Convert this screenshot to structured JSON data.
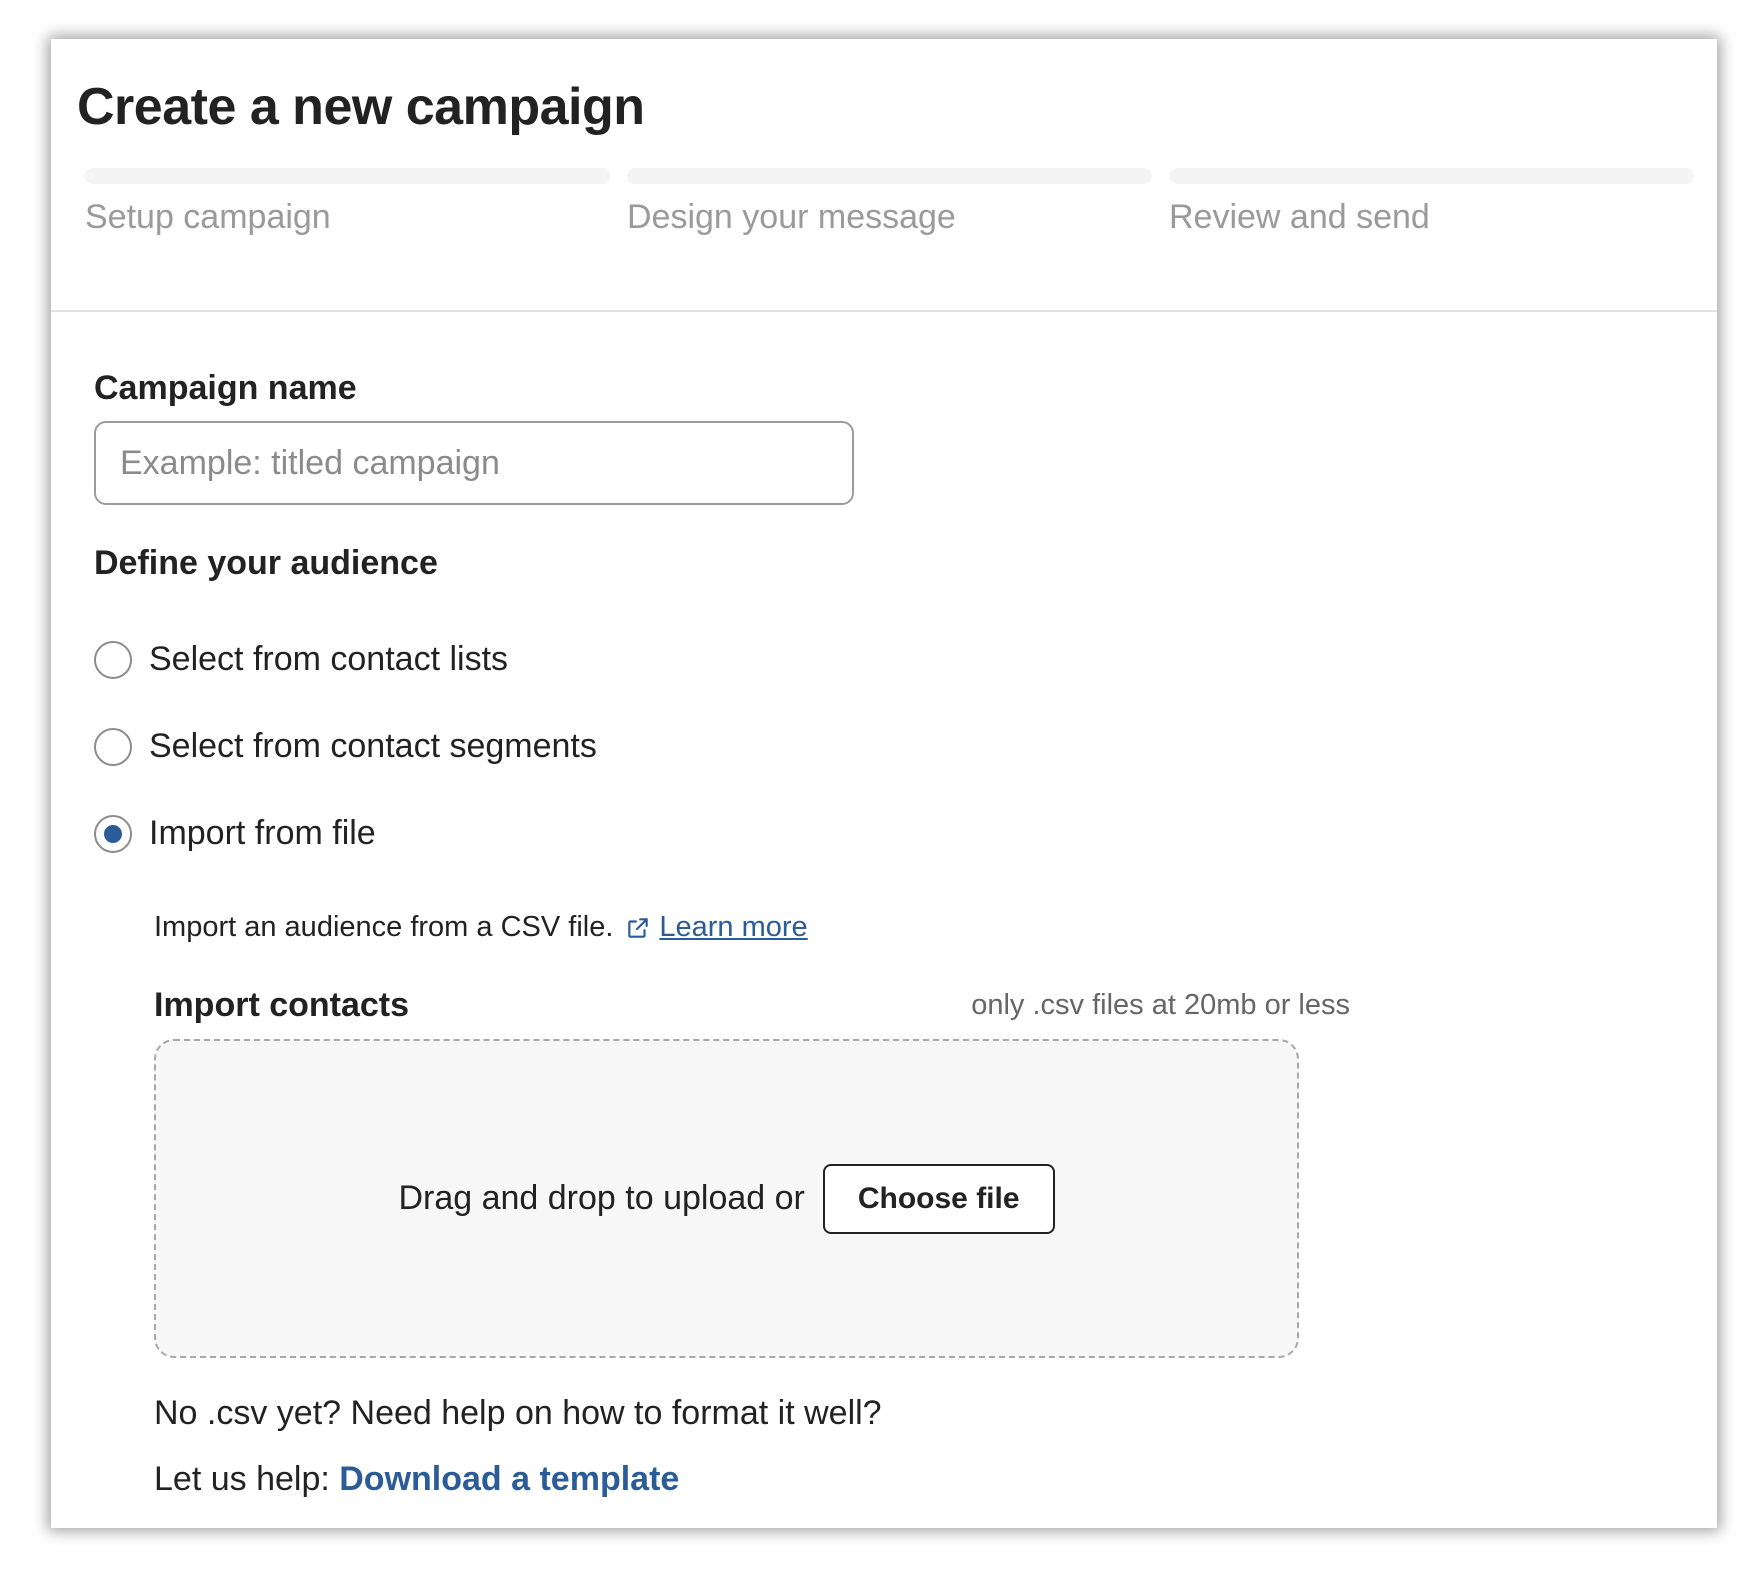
{
  "page": {
    "title": "Create a new campaign"
  },
  "steps": [
    {
      "label": "Setup campaign"
    },
    {
      "label": "Design your message"
    },
    {
      "label": "Review and send"
    }
  ],
  "campaign_name": {
    "label": "Campaign name",
    "value": "",
    "placeholder": "Example: titled campaign"
  },
  "audience": {
    "label": "Define your audience",
    "options": [
      {
        "label": "Select from contact lists",
        "selected": false
      },
      {
        "label": "Select from contact segments",
        "selected": false
      },
      {
        "label": "Import from file",
        "selected": true
      }
    ],
    "import_description": "Import an audience from a CSV file.",
    "learn_more_label": "Learn more",
    "import_icon": "external-link-icon"
  },
  "import_contacts": {
    "label": "Import contacts",
    "hint": "only .csv files at 20mb or less",
    "dropzone_text": "Drag and drop to upload or",
    "choose_file_label": "Choose file"
  },
  "help": {
    "question": "No .csv yet? Need help on how to format it well?",
    "prefix": "Let us help:",
    "download_link_label": "Download a template"
  },
  "colors": {
    "accent": "#2b5c97",
    "muted_text": "#9a9a9a",
    "progress_track": "#f4f4f4"
  }
}
